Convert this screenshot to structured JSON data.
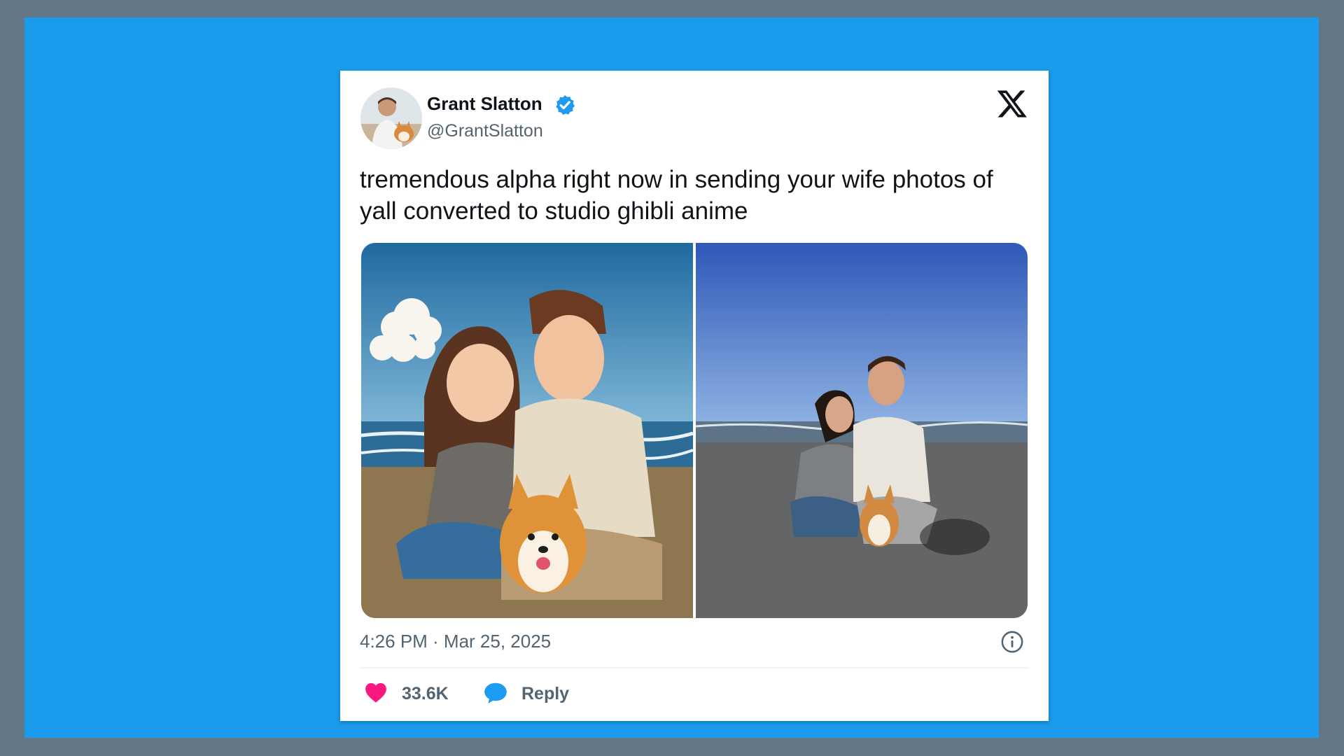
{
  "tweet": {
    "author_name": "Grant Slatton",
    "author_handle": "@GrantSlatton",
    "text": "tremendous alpha right now in sending your wife photos of yall converted to studio ghibli anime",
    "timestamp": "4:26 PM · Mar 25, 2025",
    "like_count": "33.6K",
    "reply_label": "Reply"
  },
  "colors": {
    "page_background": "#1b9bec",
    "like_heart": "#f91880",
    "reply_bubble": "#1d9bf0",
    "verified_badge": "#1d9bf0"
  },
  "icons": [
    "verified-badge-icon",
    "x-logo-icon",
    "info-icon",
    "heart-icon",
    "reply-bubble-icon"
  ]
}
